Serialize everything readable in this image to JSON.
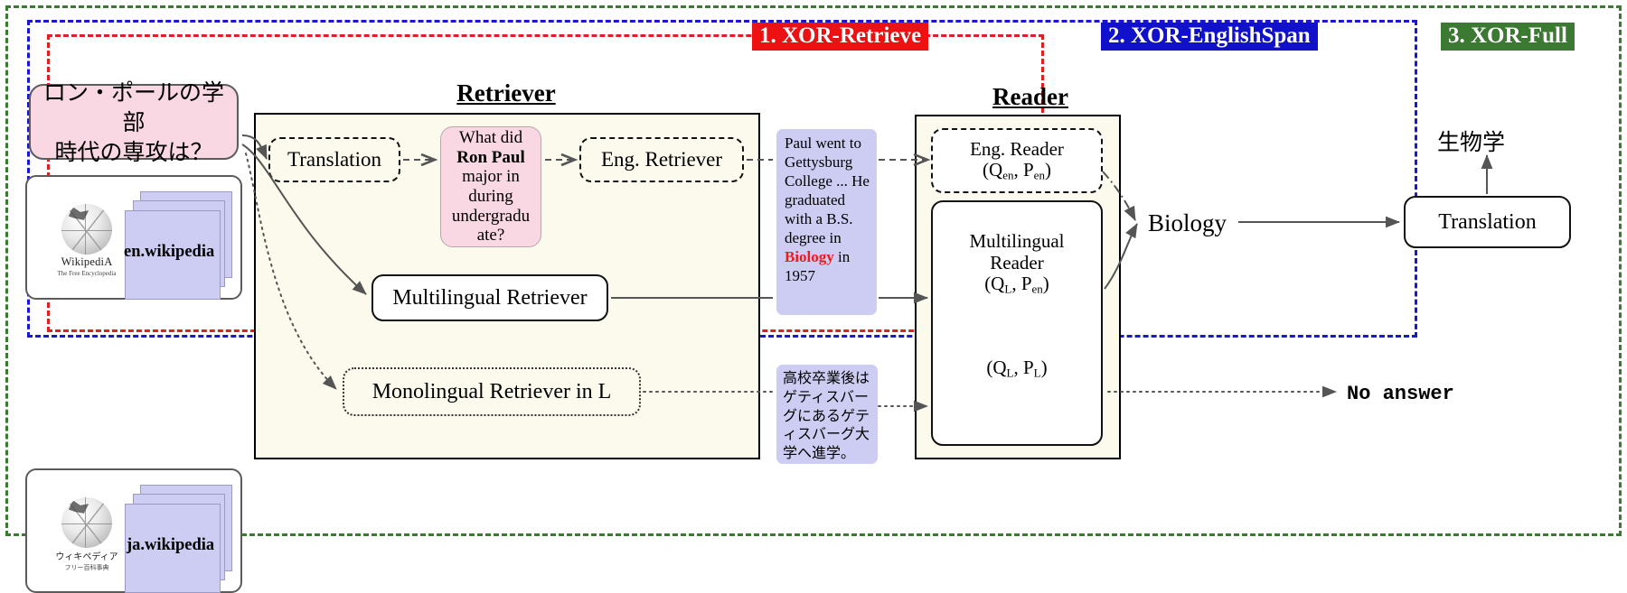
{
  "tasks": [
    {
      "label": "1. XOR-Retrieve",
      "color": "#ee1111",
      "text_color": "#ffffff"
    },
    {
      "label": "2. XOR-EnglishSpan",
      "color": "#1111cc",
      "text_color": "#ffffff"
    },
    {
      "label": "3. XOR-Full",
      "color": "#3c7a33",
      "text_color": "#ffffff"
    }
  ],
  "scopes": {
    "green_label": "xor-full-scope",
    "blue_label": "xor-englishspan-scope",
    "red_label": "xor-retrieve-scope"
  },
  "headings": {
    "retriever": "Retriever",
    "reader": "Reader"
  },
  "input": {
    "query_japanese_line1": "ロン・ポールの学部",
    "query_japanese_line2": "時代の専攻は？"
  },
  "corpora": [
    {
      "name": "en.wikipedia",
      "wiki_word": "WikipediA",
      "wiki_sub": "The Free Encyclopedia"
    },
    {
      "name": "ja.wikipedia",
      "wiki_word": "ウィキペディア",
      "wiki_sub": "フリー百科事典"
    }
  ],
  "retriever": {
    "translation_box": "Translation",
    "translated_query": {
      "l1": "What did",
      "l2": "Ron Paul",
      "l3": "major in",
      "l4": "during",
      "l5": "undergradu",
      "l6": "ate?"
    },
    "eng_retriever_box": "Eng. Retriever",
    "multilingual_retriever_box": "Multilingual Retriever",
    "monolingual_retriever_box": "Monolingual Retriever in L"
  },
  "passages": {
    "english": {
      "pre": "Paul went to Gettysburg College ... He graduated with a B.S. degree in ",
      "highlight": "Biology",
      "post": " in 1957",
      "highlight_color": "#ec1c1c"
    },
    "japanese": "高校卒業後はゲティスバーグにあるゲティスバーグ大学へ進学。"
  },
  "reader": {
    "eng_reader_title": "Eng. Reader",
    "eng_reader_args_q": "Q",
    "eng_reader_args_q_sub": "en",
    "eng_reader_args_p": "P",
    "eng_reader_args_p_sub": "en",
    "multilingual_reader_title_l1": "Multilingual",
    "multilingual_reader_title_l2": "Reader",
    "multilingual_args_top_q_sub": "L",
    "multilingual_args_top_p_sub": "en",
    "multilingual_args_bottom_q_sub": "L",
    "multilingual_args_bottom_p_sub": "L"
  },
  "outputs": {
    "english_answer": "Biology",
    "no_answer": "No answer",
    "final_translation_box": "Translation",
    "japanese_answer": "生物学"
  }
}
